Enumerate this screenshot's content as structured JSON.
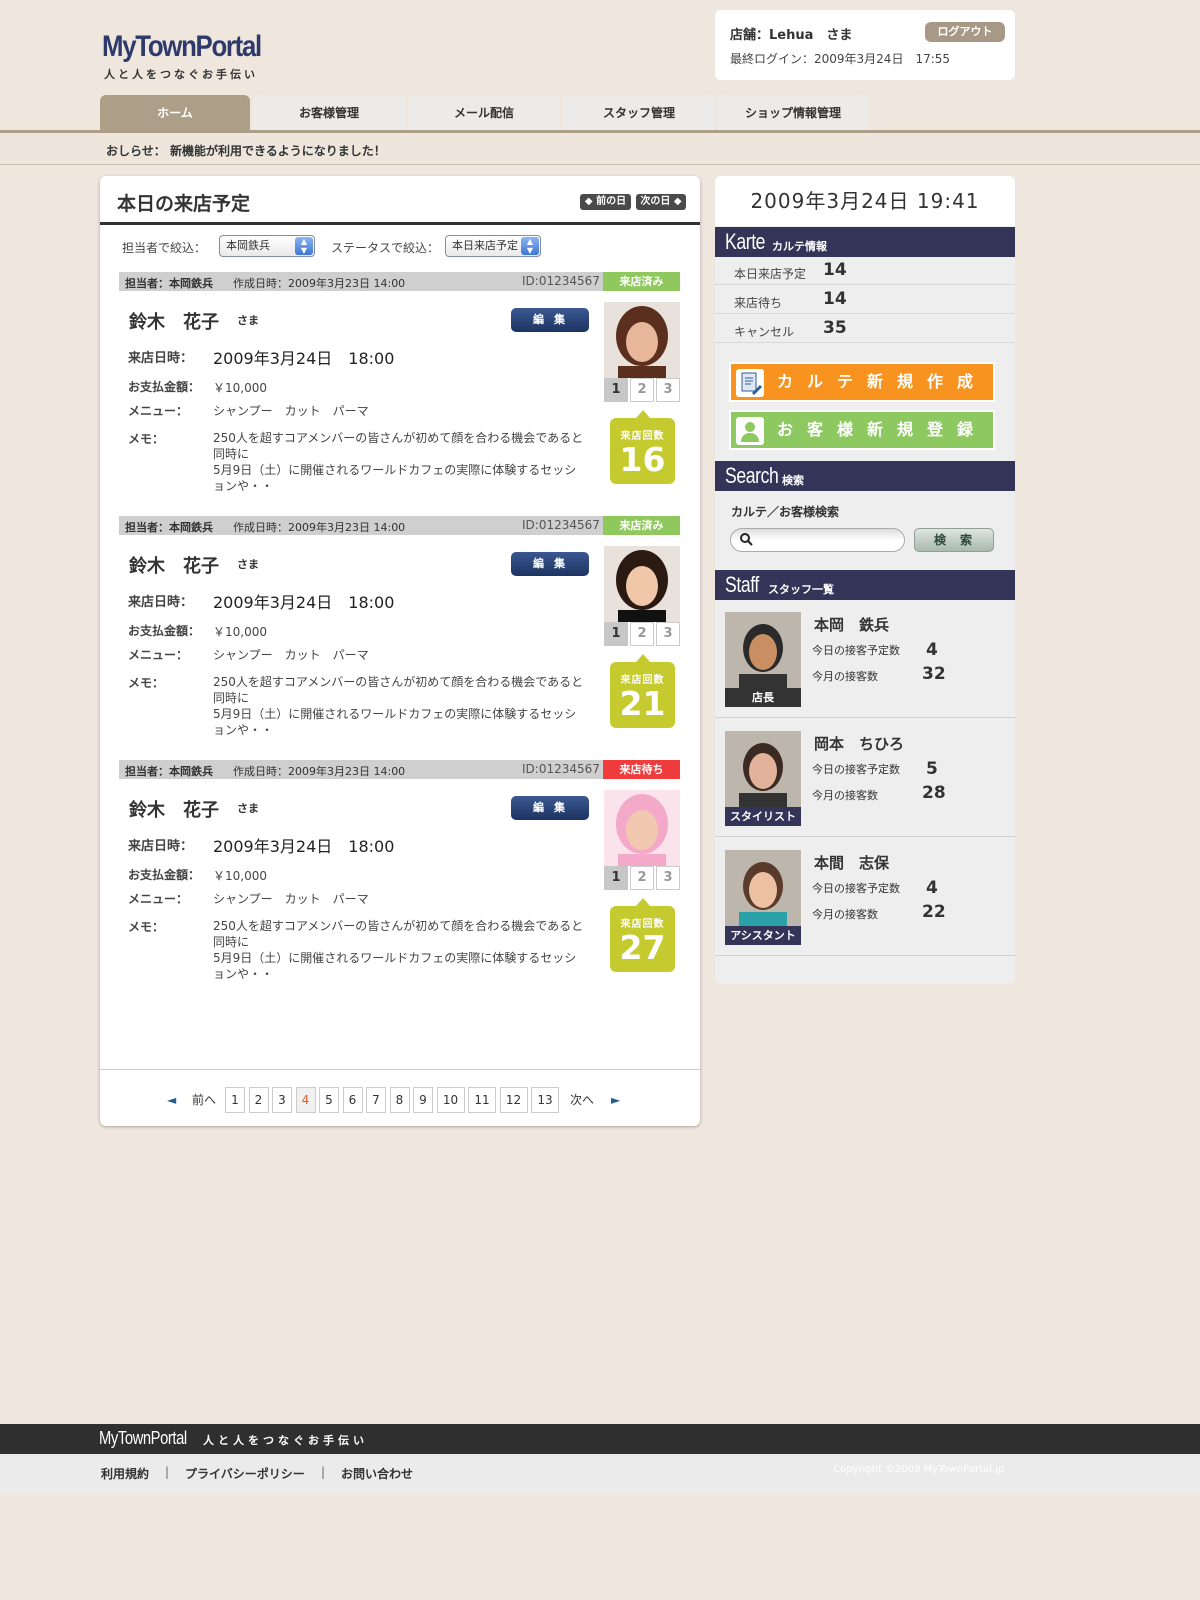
{
  "header": {
    "logo": "MyTownPortal",
    "tagline": "人と人をつなぐお手伝い",
    "shop": "店舗：Lehua　さま",
    "last_login": "最終ログイン：2009年3月24日　17:55",
    "logout": "ログアウト"
  },
  "tabs": [
    "ホーム",
    "お客様管理",
    "メール配信",
    "スタッフ管理",
    "ショップ情報管理"
  ],
  "notice": {
    "label": "おしらせ：",
    "text": "新機能が利用できるようになりました！"
  },
  "main": {
    "title": "本日の来店予定",
    "prev_day": "◆ 前の日",
    "next_day": "次の日 ◆",
    "filter_staff_label": "担当者で絞込：",
    "filter_staff_value": "本岡鉄兵",
    "filter_status_label": "ステータスで絞込：",
    "filter_status_value": "本日来店予定"
  },
  "card_labels": {
    "visit_date": "来店日時：",
    "amount": "お支払金額：",
    "menu": "メニュー：",
    "memo": "メモ：",
    "edit": "編集",
    "visits": "来店回数",
    "sama": "さま",
    "pages": [
      "1",
      "2",
      "3"
    ]
  },
  "cards": [
    {
      "staff": "担当者：本岡鉄兵",
      "created": "作成日時：2009年3月23日 14:00",
      "id": "ID:01234567",
      "status": "来店済み",
      "status_color": "#8fc85d",
      "name": "鈴木　花子",
      "visit_date": "2009年3月24日　18:00",
      "amount": "￥10,000",
      "menu": "シャンプー　カット　パーマ",
      "memo": "250人を超すコアメンバーの皆さんが初めて顔を合わる機会であると同時に\n5月9日（土）に開催されるワールドカフェの実際に体験するセッションや・・",
      "visits": "16"
    },
    {
      "staff": "担当者：本岡鉄兵",
      "created": "作成日時：2009年3月23日 14:00",
      "id": "ID:01234567",
      "status": "来店済み",
      "status_color": "#8fc85d",
      "name": "鈴木　花子",
      "visit_date": "2009年3月24日　18:00",
      "amount": "￥10,000",
      "menu": "シャンプー　カット　パーマ",
      "memo": "250人を超すコアメンバーの皆さんが初めて顔を合わる機会であると同時に\n5月9日（土）に開催されるワールドカフェの実際に体験するセッションや・・",
      "visits": "21"
    },
    {
      "staff": "担当者：本岡鉄兵",
      "created": "作成日時：2009年3月23日 14:00",
      "id": "ID:01234567",
      "status": "来店待ち",
      "status_color": "#f03c3c",
      "name": "鈴木　花子",
      "visit_date": "2009年3月24日　18:00",
      "amount": "￥10,000",
      "menu": "シャンプー　カット　パーマ",
      "memo": "250人を超すコアメンバーの皆さんが初めて顔を合わる機会であると同時に\n5月9日（土）に開催されるワールドカフェの実際に体験するセッションや・・",
      "visits": "27"
    }
  ],
  "pagination": {
    "prev": "前へ",
    "next": "次へ",
    "prev_arrow": "◄",
    "next_arrow": "►",
    "pages": [
      "1",
      "2",
      "3",
      "4",
      "5",
      "6",
      "7",
      "8",
      "9",
      "10",
      "11",
      "12",
      "13"
    ],
    "current": "4"
  },
  "sidebar": {
    "datetime": "2009年3月24日 19:41",
    "karte": {
      "title": "Karte",
      "subtitle": "カルテ情報",
      "rows": [
        {
          "label": "本日来店予定",
          "value": "14"
        },
        {
          "label": "来店待ち",
          "value": "14"
        },
        {
          "label": "キャンセル",
          "value": "35"
        }
      ]
    },
    "btn_new_karte": "カルテ新規作成",
    "btn_new_customer": "お客様新規登録",
    "search": {
      "title": "Search",
      "subtitle": "検索",
      "label": "カルテ／お客様検索",
      "placeholder": "",
      "button": "検索"
    },
    "staff": {
      "title": "Staff",
      "subtitle": "スタッフ一覧",
      "today_label": "今日の接客予定数",
      "month_label": "今月の接客数",
      "members": [
        {
          "name": "本岡　鉄兵",
          "role": "店長",
          "role_color": "#333333",
          "today": "4",
          "month": "32"
        },
        {
          "name": "岡本　ちひろ",
          "role": "スタイリスト",
          "role_color": "#343458",
          "today": "5",
          "month": "28"
        },
        {
          "name": "本間　志保",
          "role": "アシスタント",
          "role_color": "#343458",
          "today": "4",
          "month": "22"
        }
      ]
    }
  },
  "footer": {
    "logo": "MyTownPortal",
    "tagline": "人と人をつなぐお手伝い",
    "links": [
      "利用規約",
      "プライバシーポリシー",
      "お問い合わせ"
    ],
    "sep": "|",
    "copyright": "Copyright ©2009 MyTownPortal.jp"
  }
}
